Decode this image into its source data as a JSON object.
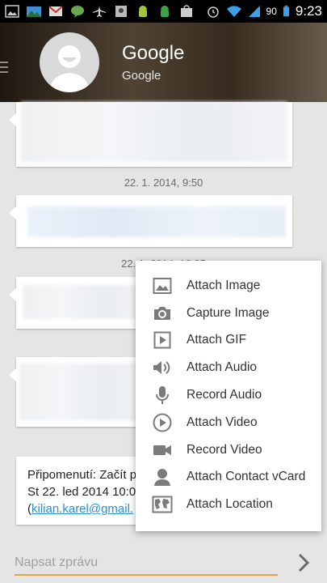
{
  "status_bar": {
    "battery_percent": "90",
    "time": "9:23",
    "icons": [
      "gallery-icon",
      "landscape-icon",
      "gmail-icon",
      "hangouts-icon",
      "airplane-icon",
      "photo-icon",
      "android-icon",
      "android-icon",
      "shopping-icon",
      "alarm-icon",
      "wifi-icon",
      "signal-icon",
      "battery-icon"
    ]
  },
  "header": {
    "title": "Google",
    "subtitle": "Google"
  },
  "messages": [
    {
      "timestamp": "22. 1. 2014, 9:50"
    },
    {
      "timestamp": "22. 1. 2014, 10:05"
    }
  ],
  "reminder": {
    "line1": "Připomenutí: Začít p",
    "line2": "St 22. led 2014 10:0",
    "line3_open": "(",
    "link": "kilian.karel@gmail."
  },
  "composer": {
    "placeholder": "Napsat zprávu"
  },
  "attach_menu": {
    "items": [
      {
        "label": "Attach Image",
        "icon": "image-icon"
      },
      {
        "label": "Capture Image",
        "icon": "camera-icon"
      },
      {
        "label": "Attach GIF",
        "icon": "gif-play-icon"
      },
      {
        "label": "Attach Audio",
        "icon": "speaker-icon"
      },
      {
        "label": "Record Audio",
        "icon": "microphone-icon"
      },
      {
        "label": "Attach Video",
        "icon": "play-circle-icon"
      },
      {
        "label": "Record Video",
        "icon": "videocam-icon"
      },
      {
        "label": "Attach Contact vCard",
        "icon": "contact-icon"
      },
      {
        "label": "Attach Location",
        "icon": "map-icon"
      }
    ]
  },
  "colors": {
    "accent": "#e8a24a",
    "link": "#2a8fd6",
    "background": "#e5e5e5",
    "icon_gray": "#7b7b7b"
  }
}
